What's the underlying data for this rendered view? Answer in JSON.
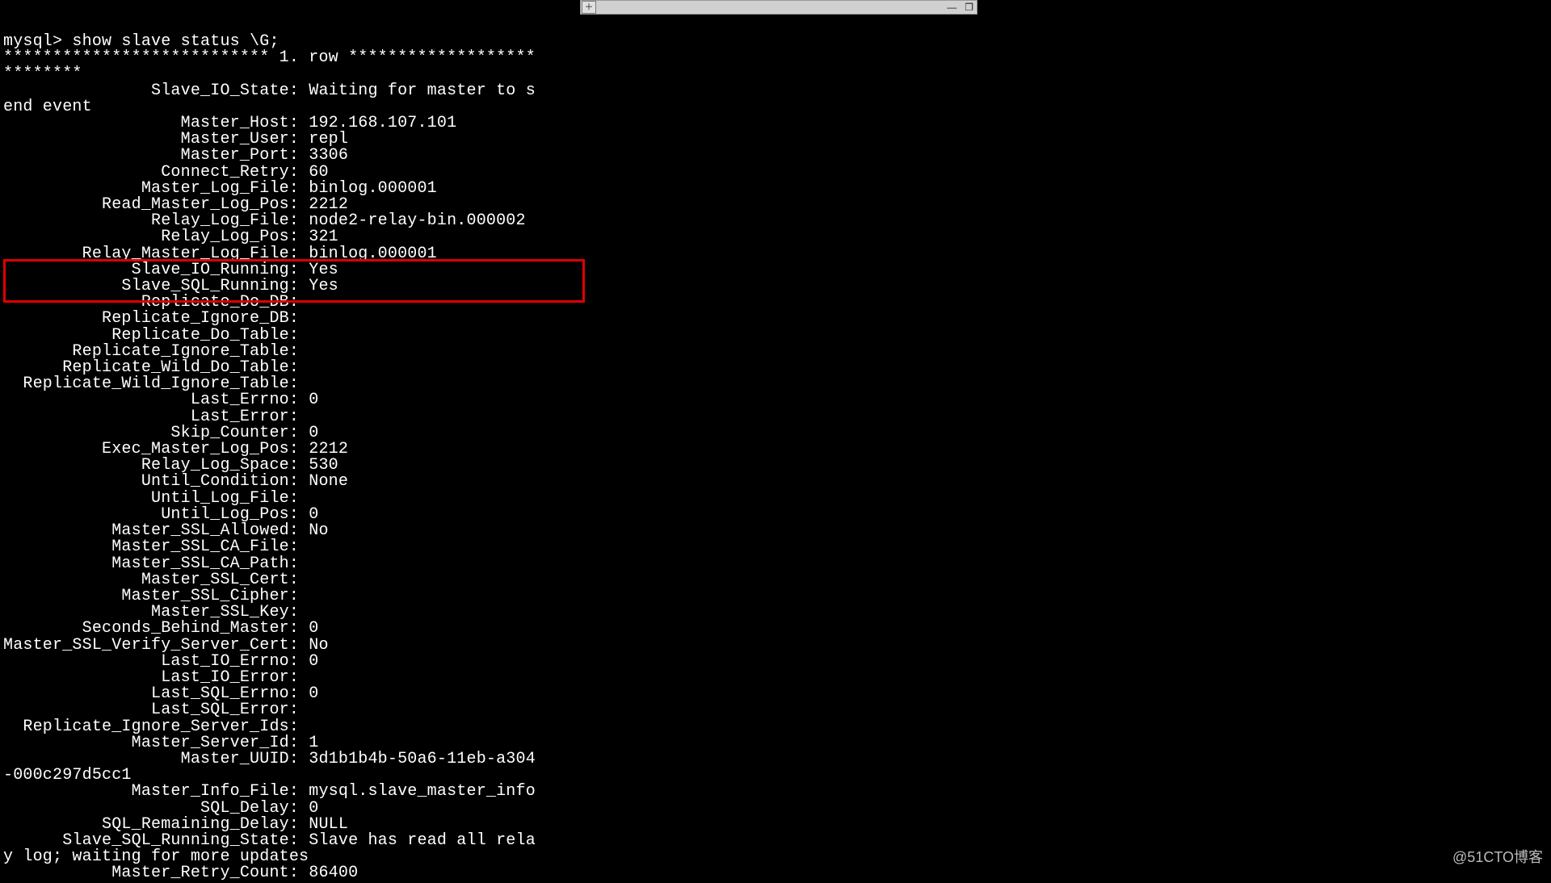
{
  "titlebar": {
    "newtab_icon": "＋",
    "minimize_icon": "—",
    "maximize_icon": "❐"
  },
  "prompt": "mysql> ",
  "command": "show slave status \\G;",
  "row_header": "*************************** 1. row ***************************",
  "fields": {
    "Slave_IO_State": "Waiting for master to send event",
    "Master_Host": "192.168.107.101",
    "Master_User": "repl",
    "Master_Port": "3306",
    "Connect_Retry": "60",
    "Master_Log_File": "binlog.000001",
    "Read_Master_Log_Pos": "2212",
    "Relay_Log_File": "node2-relay-bin.000002",
    "Relay_Log_Pos": "321",
    "Relay_Master_Log_File": "binlog.000001",
    "Slave_IO_Running": "Yes",
    "Slave_SQL_Running": "Yes",
    "Replicate_Do_DB": "",
    "Replicate_Ignore_DB": "",
    "Replicate_Do_Table": "",
    "Replicate_Ignore_Table": "",
    "Replicate_Wild_Do_Table": "",
    "Replicate_Wild_Ignore_Table": "",
    "Last_Errno": "0",
    "Last_Error": "",
    "Skip_Counter": "0",
    "Exec_Master_Log_Pos": "2212",
    "Relay_Log_Space": "530",
    "Until_Condition": "None",
    "Until_Log_File": "",
    "Until_Log_Pos": "0",
    "Master_SSL_Allowed": "No",
    "Master_SSL_CA_File": "",
    "Master_SSL_CA_Path": "",
    "Master_SSL_Cert": "",
    "Master_SSL_Cipher": "",
    "Master_SSL_Key": "",
    "Seconds_Behind_Master": "0",
    "Master_SSL_Verify_Server_Cert": "No",
    "Last_IO_Errno": "0",
    "Last_IO_Error": "",
    "Last_SQL_Errno": "0",
    "Last_SQL_Error": "",
    "Replicate_Ignore_Server_Ids": "",
    "Master_Server_Id": "1",
    "Master_UUID": "3d1b1b4b-50a6-11eb-a304-000c297d5cc1",
    "Master_Info_File": "mysql.slave_master_info",
    "SQL_Delay": "0",
    "SQL_Remaining_Delay": "NULL",
    "Slave_SQL_Running_State": "Slave has read all relay log; waiting for more updates",
    "Master_Retry_Count": "86400"
  },
  "field_order": [
    "Slave_IO_State",
    "Master_Host",
    "Master_User",
    "Master_Port",
    "Connect_Retry",
    "Master_Log_File",
    "Read_Master_Log_Pos",
    "Relay_Log_File",
    "Relay_Log_Pos",
    "Relay_Master_Log_File",
    "Slave_IO_Running",
    "Slave_SQL_Running",
    "Replicate_Do_DB",
    "Replicate_Ignore_DB",
    "Replicate_Do_Table",
    "Replicate_Ignore_Table",
    "Replicate_Wild_Do_Table",
    "Replicate_Wild_Ignore_Table",
    "Last_Errno",
    "Last_Error",
    "Skip_Counter",
    "Exec_Master_Log_Pos",
    "Relay_Log_Space",
    "Until_Condition",
    "Until_Log_File",
    "Until_Log_Pos",
    "Master_SSL_Allowed",
    "Master_SSL_CA_File",
    "Master_SSL_CA_Path",
    "Master_SSL_Cert",
    "Master_SSL_Cipher",
    "Master_SSL_Key",
    "Seconds_Behind_Master",
    "Master_SSL_Verify_Server_Cert",
    "Last_IO_Errno",
    "Last_IO_Error",
    "Last_SQL_Errno",
    "Last_SQL_Error",
    "Replicate_Ignore_Server_Ids",
    "Master_Server_Id",
    "Master_UUID",
    "Master_Info_File",
    "SQL_Delay",
    "SQL_Remaining_Delay",
    "Slave_SQL_Running_State",
    "Master_Retry_Count"
  ],
  "highlight_fields": [
    "Slave_IO_Running",
    "Slave_SQL_Running"
  ],
  "label_width": 29,
  "wrap_cols": 54,
  "watermark": "@51CTO博客"
}
